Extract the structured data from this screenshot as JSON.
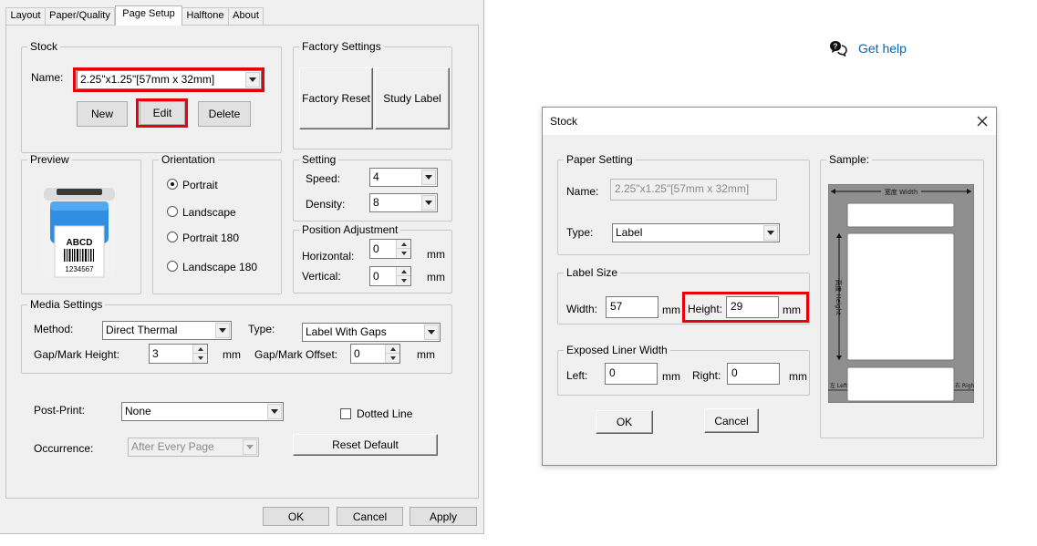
{
  "printer_dialog": {
    "tabs": [
      "Layout",
      "Paper/Quality",
      "Page Setup",
      "Halftone",
      "About"
    ],
    "active_tab": "Page Setup",
    "stock": {
      "title": "Stock",
      "name_label": "Name:",
      "name_value": "2.25\"x1.25\"[57mm x 32mm]",
      "new_label": "New",
      "edit_label": "Edit",
      "delete_label": "Delete"
    },
    "factory": {
      "title": "Factory Settings",
      "reset_label": "Factory Reset",
      "study_label": "Study Label"
    },
    "preview": {
      "title": "Preview",
      "label_text": "ABCD",
      "barcode_number": "1234567"
    },
    "orientation": {
      "title": "Orientation",
      "options": [
        "Portrait",
        "Landscape",
        "Portrait 180",
        "Landscape 180"
      ],
      "selected": "Portrait"
    },
    "setting": {
      "title": "Setting",
      "speed_label": "Speed:",
      "speed_value": "4",
      "density_label": "Density:",
      "density_value": "8"
    },
    "position": {
      "title": "Position Adjustment",
      "horizontal_label": "Horizontal:",
      "horizontal_value": "0",
      "vertical_label": "Vertical:",
      "vertical_value": "0",
      "unit": "mm"
    },
    "media": {
      "title": "Media Settings",
      "method_label": "Method:",
      "method_value": "Direct Thermal",
      "type_label": "Type:",
      "type_value": "Label With Gaps",
      "gap_height_label": "Gap/Mark Height:",
      "gap_height_value": "3",
      "gap_offset_label": "Gap/Mark Offset:",
      "gap_offset_value": "0",
      "unit": "mm"
    },
    "post_print": {
      "label": "Post-Print:",
      "value": "None",
      "dotted_line_label": "Dotted Line",
      "occurrence_label": "Occurrence:",
      "occurrence_value": "After Every Page",
      "reset_default_label": "Reset Default"
    },
    "footer": {
      "ok_label": "OK",
      "cancel_label": "Cancel",
      "apply_label": "Apply"
    }
  },
  "help": {
    "link_text": "Get help"
  },
  "stock_dialog": {
    "title": "Stock",
    "paper_setting": {
      "title": "Paper Setting",
      "name_label": "Name:",
      "name_value": "2.25\"x1.25\"[57mm x 32mm]",
      "type_label": "Type:",
      "type_value": "Label"
    },
    "label_size": {
      "title": "Label Size",
      "width_label": "Width:",
      "width_value": "57",
      "height_label": "Height:",
      "height_value": "29",
      "unit": "mm"
    },
    "liner": {
      "title": "Exposed Liner Width",
      "left_label": "Left:",
      "left_value": "0",
      "right_label": "Right:",
      "right_value": "0",
      "unit": "mm"
    },
    "ok_label": "OK",
    "cancel_label": "Cancel",
    "sample": {
      "title": "Sample:",
      "width_text": "宽度 Width",
      "height_text": "高度 Height",
      "left_text": "左 Left",
      "right_text": "右 Right"
    }
  },
  "colors": {
    "highlight_red": "#e8000b",
    "dialog_bg": "#f0f0f0",
    "link_blue": "#0067b8"
  }
}
